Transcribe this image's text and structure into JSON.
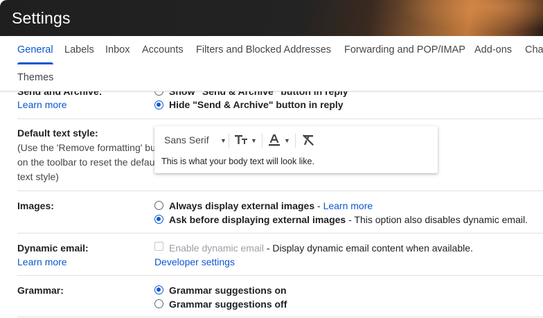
{
  "header": {
    "title": "Settings"
  },
  "tabs": [
    {
      "label": "General",
      "active": true
    },
    {
      "label": "Labels"
    },
    {
      "label": "Inbox"
    },
    {
      "label": "Accounts"
    },
    {
      "label": "Filters and Blocked Addresses"
    },
    {
      "label": "Forwarding and POP/IMAP"
    },
    {
      "label": "Add-ons"
    },
    {
      "label": "Cha"
    },
    {
      "label": "Themes"
    }
  ],
  "send_archive": {
    "label": "Send and Archive:",
    "learn_more": "Learn more",
    "options": [
      {
        "text": "Show \"Send & Archive\" button in reply",
        "checked": false
      },
      {
        "text": "Hide \"Send & Archive\" button in reply",
        "checked": true
      }
    ]
  },
  "text_style": {
    "label": "Default text style:",
    "note_lines": [
      "(Use the 'Remove formatting' button",
      "on the toolbar to reset the default",
      "text style)"
    ],
    "font": "Sans Serif",
    "sample": "This is what your body text will look like."
  },
  "images": {
    "label": "Images:",
    "options": [
      {
        "text": "Always display external images",
        "suffix": " - ",
        "link": "Learn more",
        "checked": false
      },
      {
        "text": "Ask before displaying external images",
        "suffix": " - This option also disables dynamic email.",
        "checked": true
      }
    ]
  },
  "dynamic_email": {
    "label": "Dynamic email:",
    "learn_more": "Learn more",
    "checkbox_label": "Enable dynamic email",
    "description": " - Display dynamic email content when available.",
    "developer_settings": "Developer settings",
    "checked": false
  },
  "grammar": {
    "label": "Grammar:",
    "options": [
      {
        "text": "Grammar suggestions on",
        "checked": true
      },
      {
        "text": "Grammar suggestions off",
        "checked": false
      }
    ]
  },
  "colors": {
    "accent": "#0b57d0",
    "text": "#202124",
    "muted": "#9aa0a6"
  }
}
